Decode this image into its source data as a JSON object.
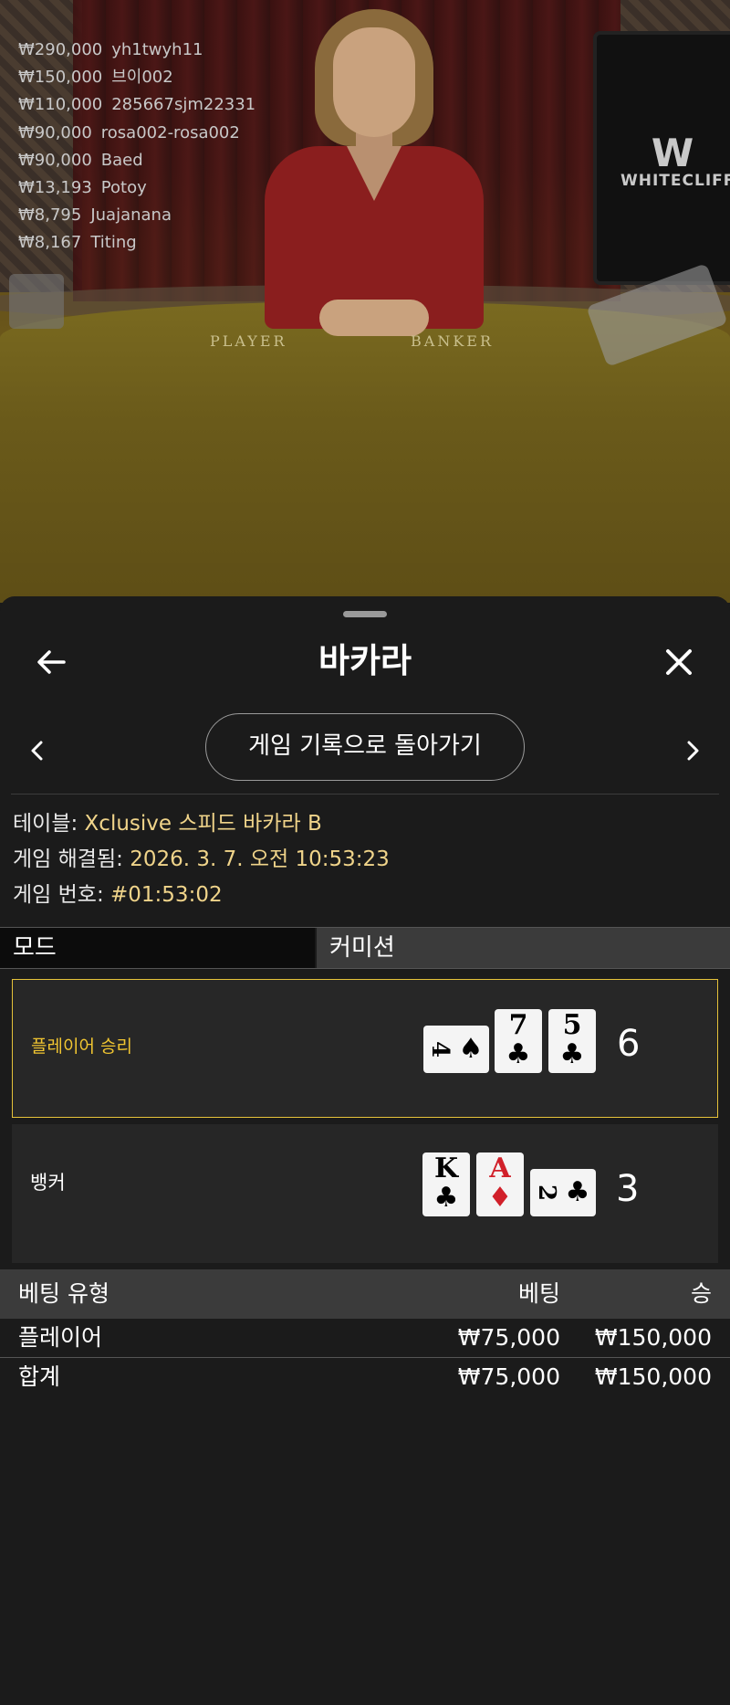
{
  "recent_winners": [
    {
      "amount": "₩290,000",
      "name": "yh1twyh11"
    },
    {
      "amount": "₩150,000",
      "name": "브이002"
    },
    {
      "amount": "₩110,000",
      "name": "285667sjm22331"
    },
    {
      "amount": "₩90,000",
      "name": "rosa002-rosa002"
    },
    {
      "amount": "₩90,000",
      "name": "Baed"
    },
    {
      "amount": "₩13,193",
      "name": "Potoy"
    },
    {
      "amount": "₩8,795",
      "name": "Juajanana"
    },
    {
      "amount": "₩8,167",
      "name": "Titing"
    }
  ],
  "stream": {
    "brand_mark": "W",
    "brand_word": "WHITECLIFF",
    "table_label_left": "PLAYER",
    "table_label_right": "BANKER"
  },
  "sheet": {
    "title": "바카라",
    "return_button": "게임 기록으로 돌아가기",
    "info": {
      "table_label": "테이블:",
      "table_value": "Xclusive 스피드 바카라 B",
      "resolved_label": "게임 해결됨:",
      "resolved_value": "2026. 3. 7. 오전 10:53:23",
      "game_no_label": "게임 번호:",
      "game_no_value": "#01:53:02"
    },
    "mode": {
      "left": "모드",
      "right": "커미션"
    },
    "player": {
      "label": "플레이어 승리",
      "score": "6",
      "cards": [
        {
          "rank": "4",
          "suit": "♠",
          "sideways": true,
          "color": "#000000"
        },
        {
          "rank": "7",
          "suit": "♣",
          "sideways": false,
          "color": "#000000"
        },
        {
          "rank": "5",
          "suit": "♣",
          "sideways": false,
          "color": "#000000"
        }
      ]
    },
    "banker": {
      "label": "뱅커",
      "score": "3",
      "cards": [
        {
          "rank": "K",
          "suit": "♣",
          "sideways": false,
          "color": "#000000"
        },
        {
          "rank": "A",
          "suit": "♦",
          "sideways": false,
          "color": "#d1202a"
        },
        {
          "rank": "2",
          "suit": "♣",
          "sideways": true,
          "color": "#000000"
        }
      ]
    },
    "bets": {
      "headers": {
        "type": "베팅 유형",
        "bet": "베팅",
        "win": "승"
      },
      "rows": [
        {
          "type": "플레이어",
          "bet": "₩75,000",
          "win": "₩150,000"
        }
      ],
      "total": {
        "type": "합계",
        "bet": "₩75,000",
        "win": "₩150,000"
      }
    }
  },
  "colors": {
    "accent_gold": "#f0c531",
    "info_value": "#f0d48a",
    "background": "#1b1b1b"
  }
}
